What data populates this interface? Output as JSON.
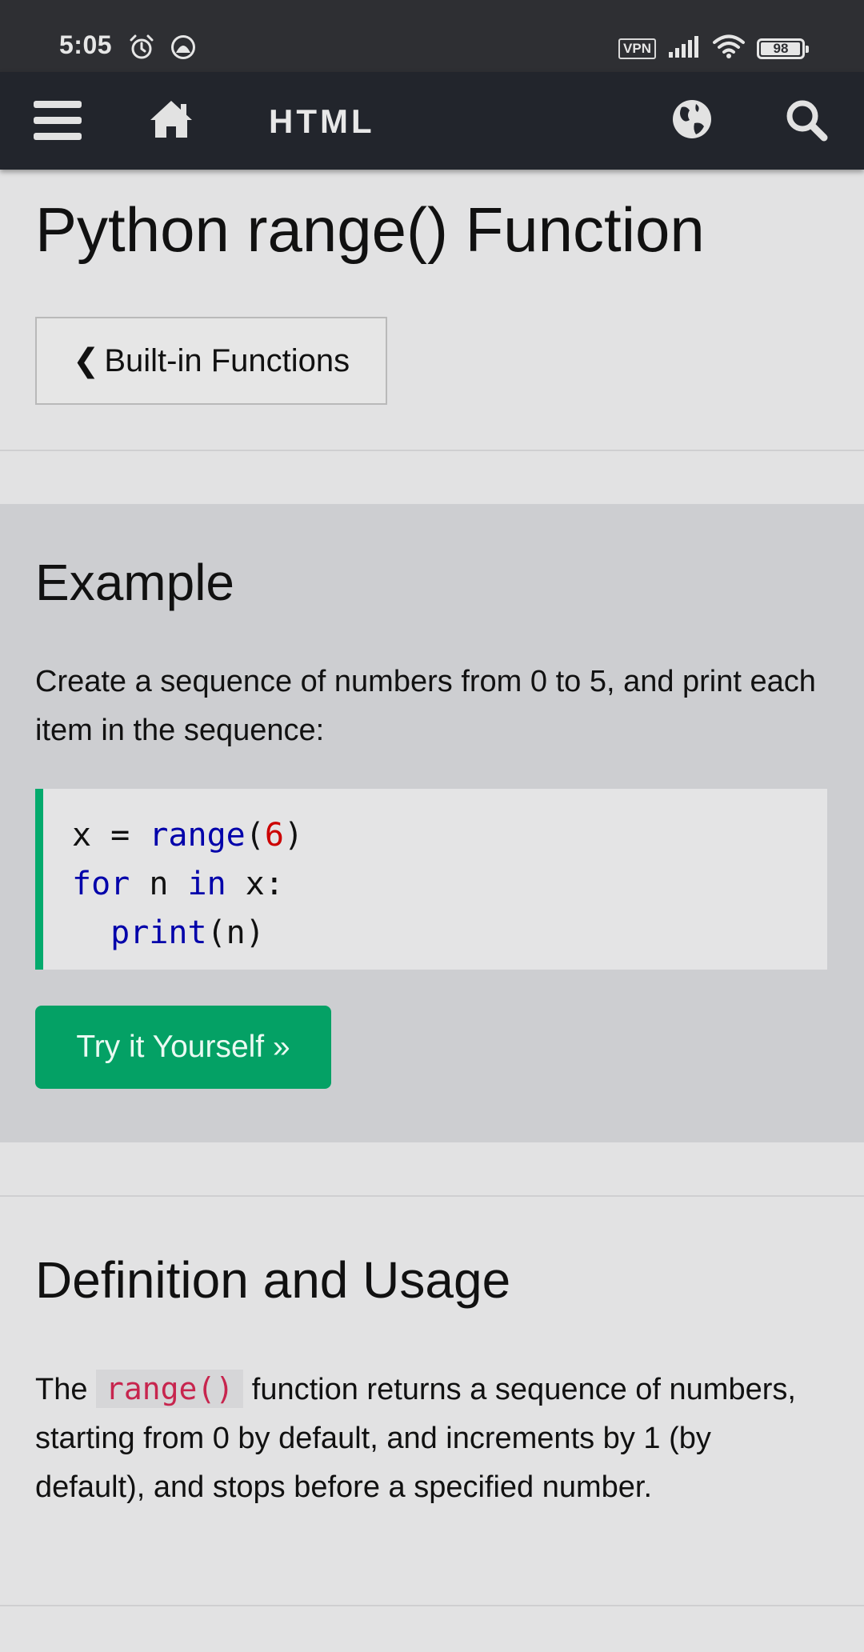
{
  "status_bar": {
    "time": "5:05",
    "vpn": "VPN",
    "battery": "98",
    "battery_level": 0.98,
    "icons": [
      "alarm-icon",
      "app-icon",
      "signal-icon",
      "wifi-icon",
      "battery-icon"
    ]
  },
  "nav": {
    "title": "HTML",
    "icons": [
      "menu-icon",
      "home-icon",
      "globe-icon",
      "search-icon"
    ]
  },
  "page": {
    "title": "Python range() Function",
    "back_button": "Built-in Functions",
    "back_chevron": "❮"
  },
  "example": {
    "heading": "Example",
    "description": "Create a sequence of numbers from 0 to 5, and print each item in the sequence:",
    "code": {
      "line1": {
        "a": "x = ",
        "fn": "range",
        "b": "(",
        "num": "6",
        "c": ")"
      },
      "line2": {
        "kw1": "for",
        "a": " n ",
        "kw2": "in",
        "b": " x:"
      },
      "line3": {
        "indent": "  ",
        "fn": "print",
        "a": "(n)"
      }
    },
    "try_button": "Try it Yourself »"
  },
  "definition": {
    "heading": "Definition and Usage",
    "text_before": "The ",
    "code": "range()",
    "text_after": " function returns a sequence of numbers, starting from 0 by default, and increments by 1 (by default), and stops before a specified number."
  },
  "colors": {
    "status_bar": "#2e2f33",
    "nav_bar": "#22252c",
    "page_bg": "#e2e2e3",
    "example_bg": "#cdced1",
    "accent_green": "#04aa6d",
    "keyword": "#0000aa",
    "number": "#cc0000",
    "inline_code": "#c7254e"
  }
}
